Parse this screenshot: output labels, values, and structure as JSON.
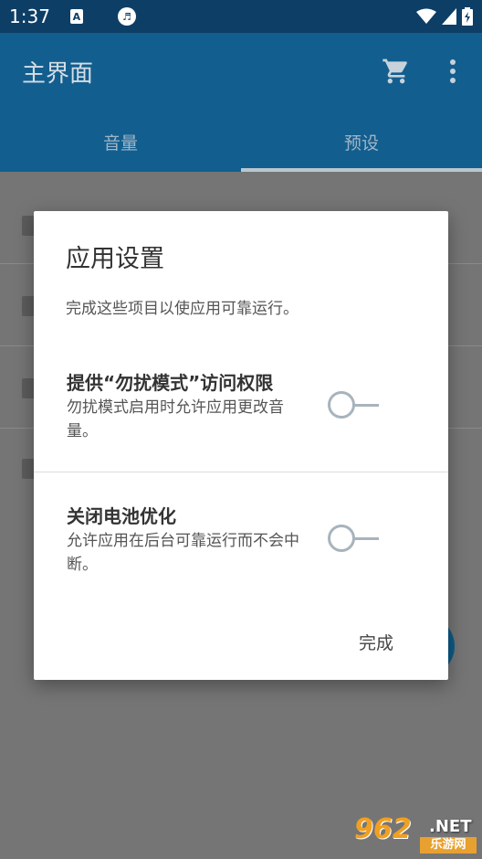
{
  "status_bar": {
    "time": "1:37",
    "notification_icon_letter": "A",
    "icons": [
      "a-notification-icon",
      "sound-icon",
      "wifi-icon",
      "signal-icon",
      "battery-icon"
    ]
  },
  "app_bar": {
    "title": "主界面",
    "icons": [
      "cart-icon",
      "more-vert-icon"
    ]
  },
  "tabs": [
    {
      "label": "音量",
      "active": false
    },
    {
      "label": "预设",
      "active": true
    }
  ],
  "dialog": {
    "title": "应用设置",
    "subtitle": "完成这些项目以使应用可靠运行。",
    "permissions": [
      {
        "title": "提供“勿扰模式”访问权限",
        "description": "勿扰模式启用时允许应用更改音量。",
        "enabled": false
      },
      {
        "title": "关闭电池优化",
        "description": "允许应用在后台可靠运行而不会中断。",
        "enabled": false
      }
    ],
    "done_label": "完成"
  },
  "watermark": {
    "number": "962",
    "suffix": ".NET",
    "site_name": "乐游网"
  },
  "colors": {
    "status_bar": "#0d3e66",
    "app_bar": "#125e8f",
    "scrim": "#757575",
    "toggle": "#a8b4bc"
  }
}
